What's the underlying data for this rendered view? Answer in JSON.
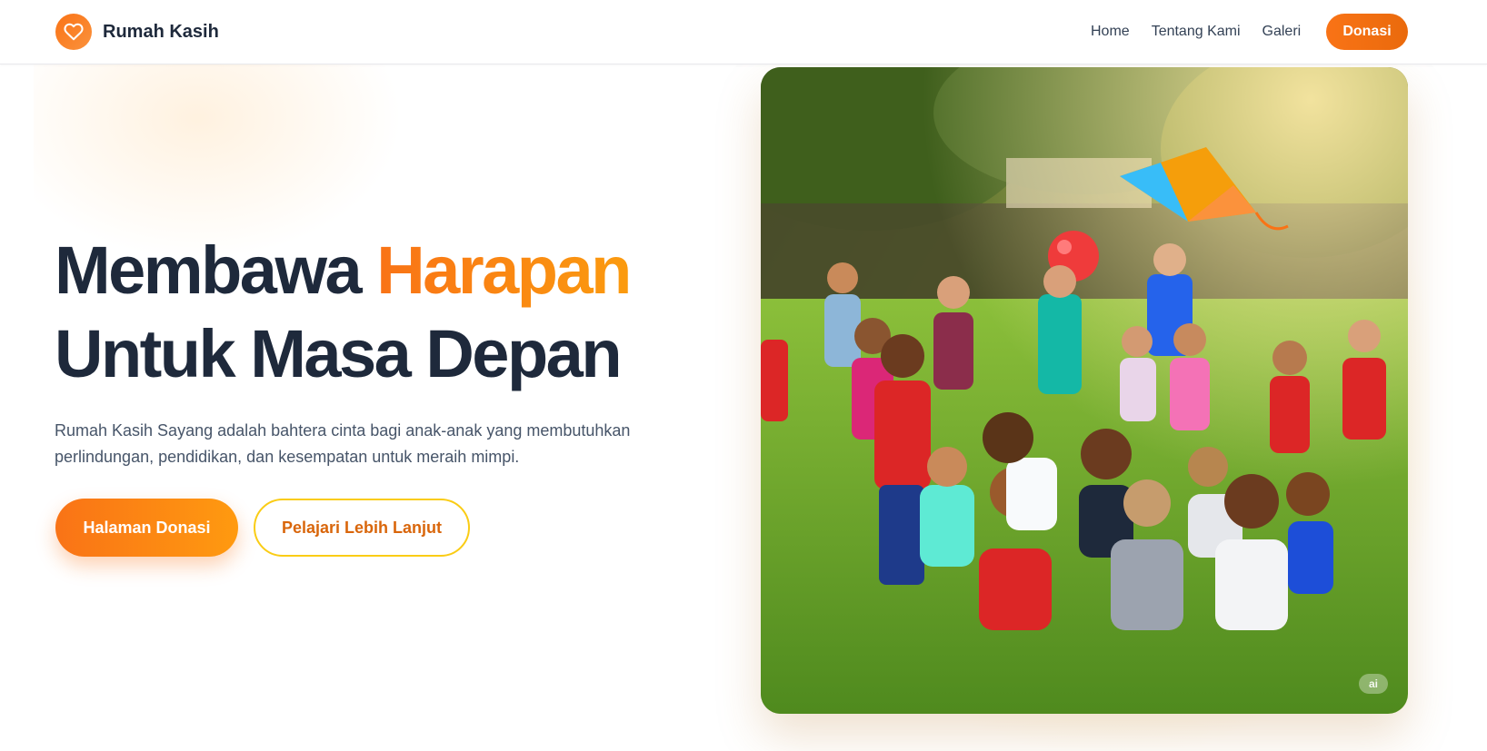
{
  "brand": {
    "name": "Rumah Kasih",
    "logo_icon": "heart-icon",
    "accent": "#f97316"
  },
  "nav": {
    "links": [
      "Home",
      "Tentang Kami",
      "Galeri"
    ],
    "donate_label": "Donasi"
  },
  "hero": {
    "title_part1": "Membawa",
    "title_accent": "Harapan",
    "title_part2": "Untuk Masa Depan",
    "description": "Rumah Kasih Sayang adalah bahtera cinta bagi anak-anak yang membutuhkan perlindungan, pendidikan, dan kesempatan untuk meraih mimpi.",
    "primary_button": "Halaman Donasi",
    "secondary_button": "Pelajari Lebih Lanjut",
    "image_alt": "Anak-anak bermain bersama di taman",
    "image_badge": "ai"
  },
  "colors": {
    "primary": "#f97316",
    "primary_light": "#ff9a10",
    "heading": "#1e293b",
    "text": "#475569",
    "outline": "#facc15"
  }
}
